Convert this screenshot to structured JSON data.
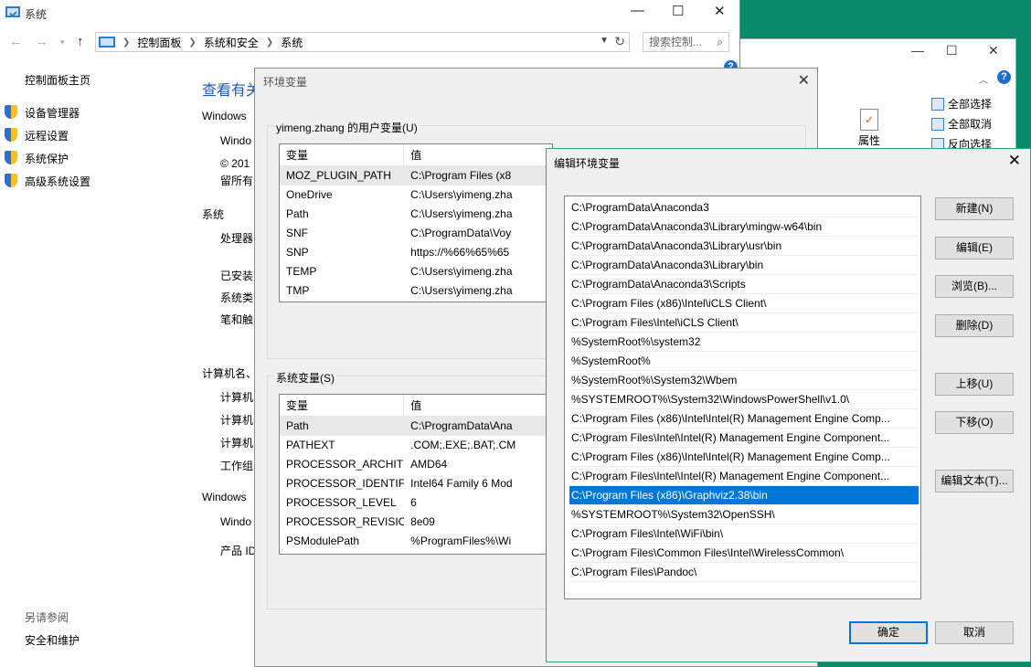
{
  "explorer": {
    "ribbon_items": [
      "全部选择",
      "全部取消",
      "反向选择"
    ],
    "properties_label": "属性"
  },
  "system_window": {
    "title": "系统",
    "breadcrumbs": [
      "控制面板",
      "系统和安全",
      "系统"
    ],
    "search_placeholder": "搜索控制...",
    "sidebar": {
      "home": "控制面板主页",
      "links": [
        "设备管理器",
        "远程设置",
        "系统保护",
        "高级系统设置"
      ],
      "see_also_title": "另请参阅",
      "see_also_link": "安全和维护"
    },
    "main": {
      "heading": "查看有关",
      "lines": [
        "Windows",
        "Windo",
        "© 201",
        "留所有",
        "系统",
        "处理器",
        "已安装",
        "系统类",
        "笔和触",
        "计算机名、",
        "计算机",
        "计算机",
        "计算机",
        "工作组",
        "Windows",
        "Windo",
        "产品 ID"
      ]
    }
  },
  "env_dialog": {
    "title": "环境变量",
    "user_group_label": "yimeng.zhang 的用户变量(U)",
    "system_group_label": "系统变量(S)",
    "col_var": "变量",
    "col_val": "值",
    "user_vars": [
      {
        "name": "MOZ_PLUGIN_PATH",
        "value": "C:\\Program Files (x8"
      },
      {
        "name": "OneDrive",
        "value": "C:\\Users\\yimeng.zha"
      },
      {
        "name": "Path",
        "value": "C:\\Users\\yimeng.zha"
      },
      {
        "name": "SNF",
        "value": "C:\\ProgramData\\Voy"
      },
      {
        "name": "SNP",
        "value": "https://%66%65%65"
      },
      {
        "name": "TEMP",
        "value": "C:\\Users\\yimeng.zha"
      },
      {
        "name": "TMP",
        "value": "C:\\Users\\yimeng.zha"
      }
    ],
    "system_vars": [
      {
        "name": "Path",
        "value": "C:\\ProgramData\\Ana"
      },
      {
        "name": "PATHEXT",
        "value": ".COM;.EXE;.BAT;.CM"
      },
      {
        "name": "PROCESSOR_ARCHITECT...",
        "value": "AMD64"
      },
      {
        "name": "PROCESSOR_IDENTIFIER",
        "value": "Intel64 Family 6 Mod"
      },
      {
        "name": "PROCESSOR_LEVEL",
        "value": "6"
      },
      {
        "name": "PROCESSOR_REVISION",
        "value": "8e09"
      },
      {
        "name": "PSModulePath",
        "value": "%ProgramFiles%\\Wi"
      }
    ]
  },
  "edit_dialog": {
    "title": "编辑环境变量",
    "paths": [
      "C:\\ProgramData\\Anaconda3",
      "C:\\ProgramData\\Anaconda3\\Library\\mingw-w64\\bin",
      "C:\\ProgramData\\Anaconda3\\Library\\usr\\bin",
      "C:\\ProgramData\\Anaconda3\\Library\\bin",
      "C:\\ProgramData\\Anaconda3\\Scripts",
      "C:\\Program Files (x86)\\Intel\\iCLS Client\\",
      "C:\\Program Files\\Intel\\iCLS Client\\",
      "%SystemRoot%\\system32",
      "%SystemRoot%",
      "%SystemRoot%\\System32\\Wbem",
      "%SYSTEMROOT%\\System32\\WindowsPowerShell\\v1.0\\",
      "C:\\Program Files (x86)\\Intel\\Intel(R) Management Engine Comp...",
      "C:\\Program Files\\Intel\\Intel(R) Management Engine Component...",
      "C:\\Program Files (x86)\\Intel\\Intel(R) Management Engine Comp...",
      "C:\\Program Files\\Intel\\Intel(R) Management Engine Component...",
      "C:\\Program Files (x86)\\Graphviz2.38\\bin",
      "%SYSTEMROOT%\\System32\\OpenSSH\\",
      "C:\\Program Files\\Intel\\WiFi\\bin\\",
      "C:\\Program Files\\Common Files\\Intel\\WirelessCommon\\",
      "C:\\Program Files\\Pandoc\\"
    ],
    "selected_index": 15,
    "buttons": {
      "new": "新建(N)",
      "edit": "编辑(E)",
      "browse": "浏览(B)...",
      "delete": "删除(D)",
      "move_up": "上移(U)",
      "move_down": "下移(O)",
      "edit_text": "编辑文本(T)...",
      "ok": "确定",
      "cancel": "取消"
    }
  }
}
